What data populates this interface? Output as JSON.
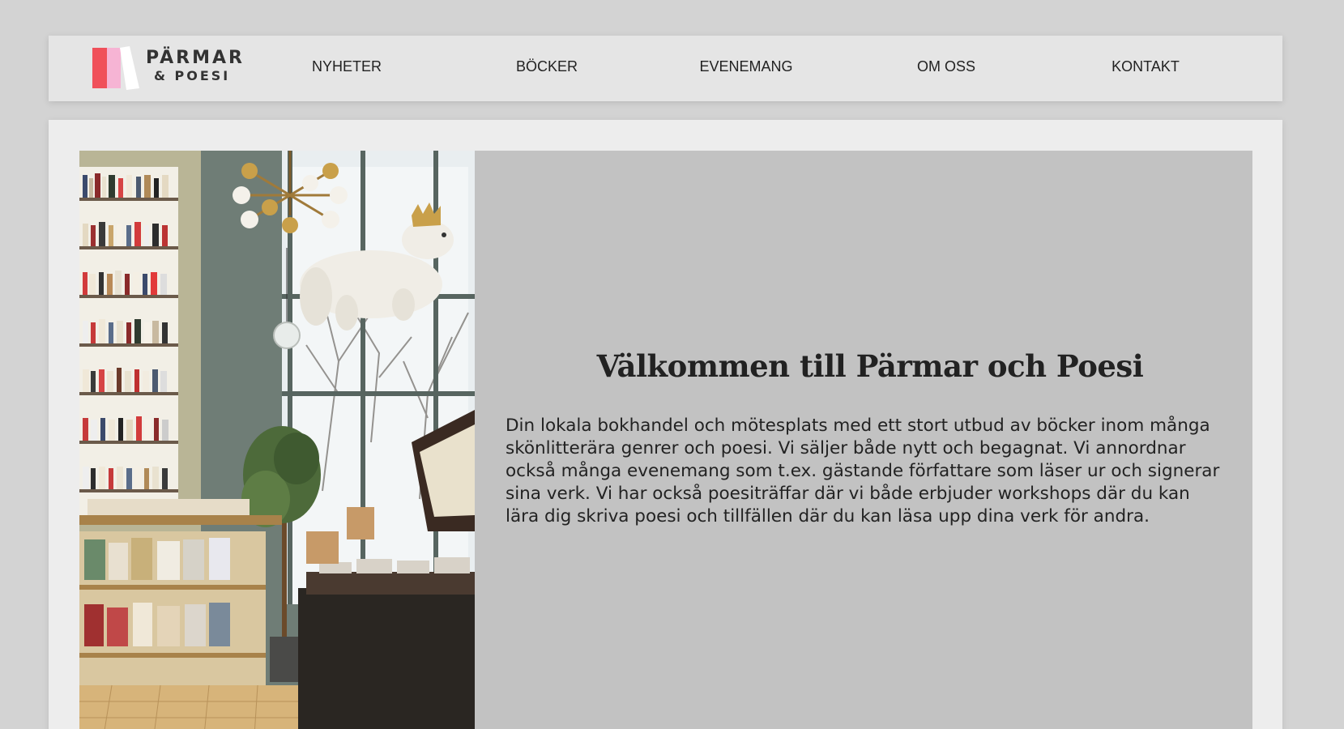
{
  "brand": {
    "name_line1": "PÄRMAR",
    "name_line2": "& POESI",
    "colors": {
      "red": "#f0505a",
      "pink": "#f6b4d4",
      "white": "#ffffff"
    }
  },
  "nav": {
    "items": [
      {
        "label": "NYHETER"
      },
      {
        "label": "BÖCKER"
      },
      {
        "label": "EVENEMANG"
      },
      {
        "label": "OM OSS"
      },
      {
        "label": "KONTAKT"
      }
    ]
  },
  "hero": {
    "image_icon": "bookstore-photo",
    "title": "Välkommen till Pärmar och Poesi",
    "text": "Din lokala bokhandel och mötesplats med ett stort utbud av böcker inom många skönlitterära genrer och poesi. Vi säljer både nytt och begagnat. Vi annordnar också många evenemang som t.ex. gästande författare som läser ur och signerar sina verk. Vi har också poesiträffar där vi både erbjuder workshops där du kan lära dig skriva poesi och tillfällen där du kan läsa upp dina verk för andra."
  },
  "colors": {
    "page_bg": "#d3d3d3",
    "nav_bg": "#e5e5e5",
    "card_bg": "#ededed",
    "hero_bg": "#c2c2c2",
    "text": "#222222"
  }
}
